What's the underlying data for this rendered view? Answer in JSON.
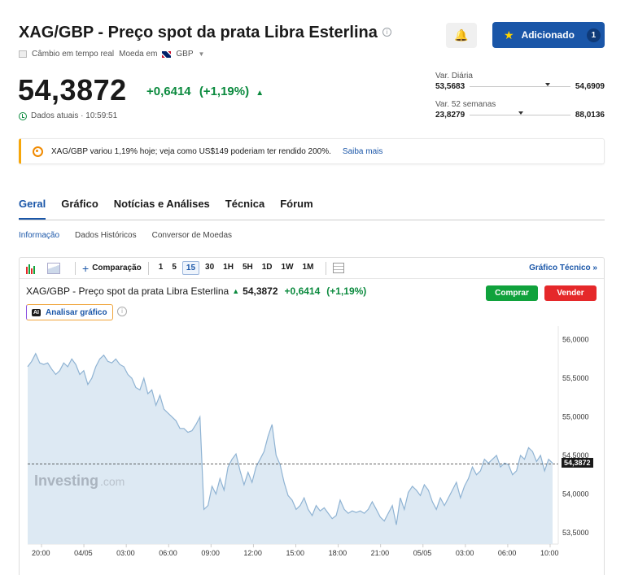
{
  "header": {
    "title": "XAG/GBP - Preço spot da prata Libra Esterlina",
    "realtime_label": "Câmbio em tempo real",
    "currency_label": "Moeda em",
    "currency_value": "GBP",
    "added_label": "Adicionado",
    "added_count": "1"
  },
  "quote": {
    "price": "54,3872",
    "change": "+0,6414",
    "change_pct": "(+1,19%)",
    "data_time": "Dados atuais · 10:59:51"
  },
  "ranges": {
    "daily": {
      "label": "Var. Diária",
      "low": "53,5683",
      "high": "54,6909",
      "position": 0.75
    },
    "week52": {
      "label": "Var. 52 semanas",
      "low": "23,8279",
      "high": "88,0136",
      "position": 0.48
    }
  },
  "banner": {
    "text": "XAG/GBP variou 1,19% hoje; veja como US$149 poderiam ter rendido 200%.",
    "link": "Saiba mais"
  },
  "tabs": [
    "Geral",
    "Gráfico",
    "Notícias e Análises",
    "Técnica",
    "Fórum"
  ],
  "subtabs": [
    "Informação",
    "Dados Históricos",
    "Conversor de Moedas"
  ],
  "toolbar": {
    "compare": "Comparação",
    "timeframes": [
      "1",
      "5",
      "15",
      "30",
      "1H",
      "5H",
      "1D",
      "1W",
      "1M"
    ],
    "active_timeframe": "15",
    "technical_chart": "Gráfico Técnico »"
  },
  "chart_header": {
    "name": "XAG/GBP - Preço spot da prata Libra Esterlina",
    "price": "54,3872",
    "change": "+0,6414",
    "change_pct": "(+1,19%)",
    "buy": "Comprar",
    "sell": "Vender",
    "ai_label": "Analisar gráfico",
    "ai_badge": "AI",
    "watermark": "Investing",
    "watermark_suffix": ".com"
  },
  "colors": {
    "accent": "#1a56a8",
    "up": "#0b8a3e",
    "sell": "#e5282a",
    "buy": "#10a23c",
    "area": "#dde9f3",
    "line": "#8fb3d3"
  },
  "chart_data": {
    "type": "area",
    "ylim": [
      53.35,
      56.05
    ],
    "yticks": [
      "56,0000",
      "55,5000",
      "55,0000",
      "54,5000",
      "54,0000",
      "53,5000"
    ],
    "ytick_values": [
      56.0,
      55.5,
      55.0,
      54.5,
      54.0,
      53.5
    ],
    "xticks": [
      "20:00",
      "04/05",
      "03:00",
      "06:00",
      "09:00",
      "12:00",
      "15:00",
      "18:00",
      "21:00",
      "05/05",
      "03:00",
      "06:00",
      "10:00"
    ],
    "last_price": 54.3872,
    "last_price_label": "54,3872",
    "values": [
      55.65,
      55.72,
      55.82,
      55.7,
      55.68,
      55.7,
      55.62,
      55.55,
      55.6,
      55.7,
      55.65,
      55.75,
      55.68,
      55.55,
      55.6,
      55.42,
      55.5,
      55.65,
      55.75,
      55.8,
      55.72,
      55.7,
      55.75,
      55.68,
      55.65,
      55.55,
      55.5,
      55.38,
      55.35,
      55.5,
      55.3,
      55.35,
      55.15,
      55.28,
      55.1,
      55.05,
      55.0,
      54.95,
      54.85,
      54.85,
      54.8,
      54.82,
      54.9,
      55.0,
      53.8,
      53.85,
      54.1,
      54.0,
      54.2,
      54.05,
      54.35,
      54.45,
      54.52,
      54.3,
      54.12,
      54.28,
      54.15,
      54.35,
      54.45,
      54.55,
      54.75,
      54.9,
      54.5,
      54.38,
      54.15,
      53.98,
      53.92,
      53.8,
      53.85,
      53.95,
      53.8,
      53.72,
      53.85,
      53.78,
      53.82,
      53.75,
      53.68,
      53.72,
      53.92,
      53.8,
      53.75,
      53.78,
      53.76,
      53.78,
      53.75,
      53.8,
      53.9,
      53.8,
      53.7,
      53.65,
      53.75,
      53.85,
      53.6,
      53.95,
      53.8,
      54.02,
      54.1,
      54.05,
      53.98,
      54.12,
      54.05,
      53.9,
      53.8,
      53.95,
      53.85,
      53.95,
      54.05,
      54.15,
      53.95,
      54.1,
      54.2,
      54.35,
      54.25,
      54.3,
      54.45,
      54.4,
      54.45,
      54.5,
      54.35,
      54.4,
      54.38,
      54.25,
      54.3,
      54.5,
      54.45,
      54.6,
      54.55,
      54.42,
      54.5,
      54.3,
      54.45,
      54.4
    ]
  }
}
